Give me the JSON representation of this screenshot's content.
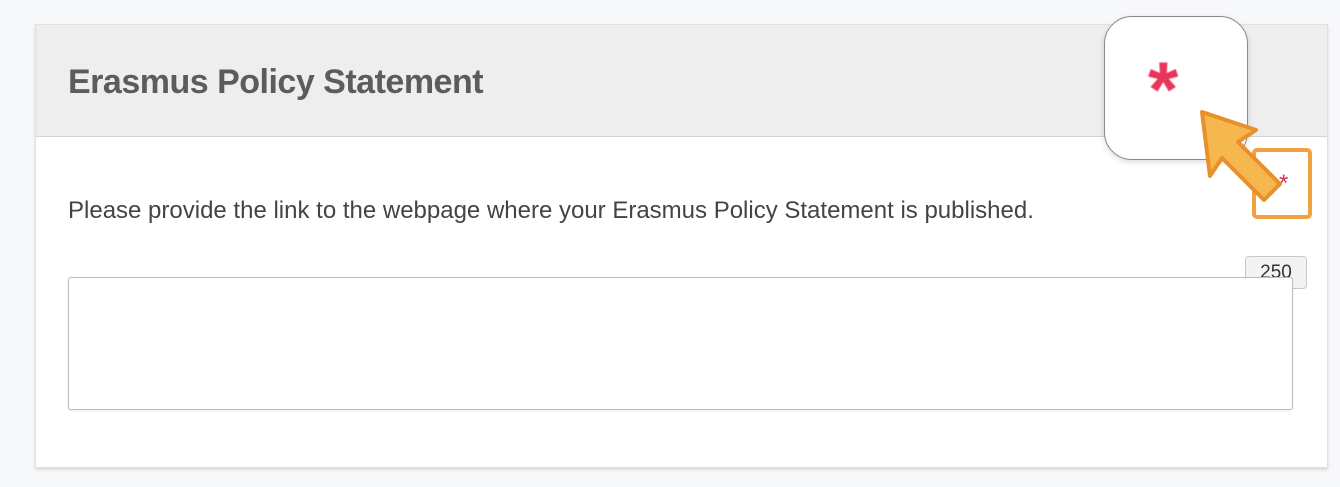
{
  "section": {
    "title": "Erasmus Policy Statement"
  },
  "question": {
    "label": "Please provide the link to the webpage where your Erasmus Policy Statement is published.",
    "required_marker": "*",
    "char_limit": "250",
    "value": "",
    "placeholder": ""
  },
  "callout": {
    "zoom_marker": "*",
    "highlight_color": "#f2a13f",
    "marker_color": "#e8355a"
  }
}
